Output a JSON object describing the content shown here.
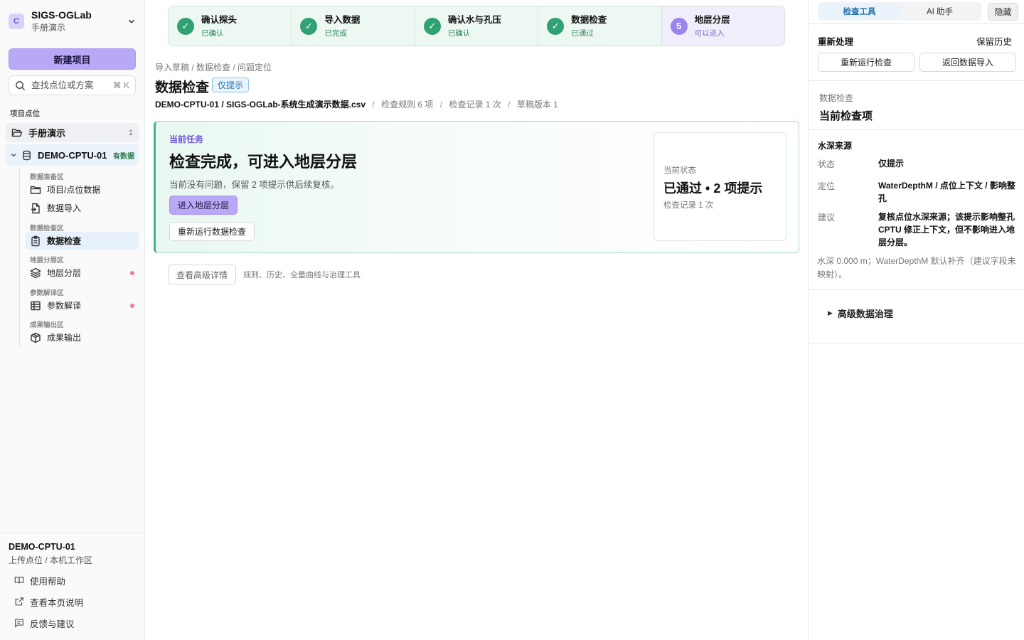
{
  "workspace": {
    "avatar": "C",
    "title": "SIGS-OGLab",
    "subtitle": "手册演示"
  },
  "sidebar": {
    "new_project": "新建项目",
    "search_placeholder": "查找点位或方案",
    "search_shortcut": "⌘ K",
    "section_label": "项目点位",
    "project": {
      "label": "手册演示",
      "count": "1"
    },
    "site": {
      "label": "DEMO-CPTU-01",
      "tag": "有数据"
    },
    "groups": [
      "数据准备区",
      "数据检查区",
      "地层分层区",
      "参数解译区",
      "成果输出区"
    ],
    "items": [
      {
        "label": "项目/点位数据"
      },
      {
        "label": "数据导入"
      },
      {
        "label": "数据检查"
      },
      {
        "label": "地层分层"
      },
      {
        "label": "参数解译"
      },
      {
        "label": "成果输出"
      }
    ],
    "footer": {
      "title": "DEMO-CPTU-01",
      "subtitle": "上传点位 / 本机工作区",
      "links": [
        "使用帮助",
        "查看本页说明",
        "反馈与建议"
      ]
    }
  },
  "steps": [
    {
      "title": "确认探头",
      "status": "已确认"
    },
    {
      "title": "导入数据",
      "status": "已完成"
    },
    {
      "title": "确认水与孔压",
      "status": "已确认"
    },
    {
      "title": "数据检查",
      "status": "已通过"
    },
    {
      "num": "5",
      "title": "地层分层",
      "status": "可以进入"
    }
  ],
  "main": {
    "breadcrumb": "导入草稿 / 数据检查 / 问题定位",
    "title": "数据检查",
    "badge": "仅提示",
    "meta": {
      "file": "DEMO-CPTU-01 / SIGS-OGLab-系统生成演示数据.csv",
      "rules": "检查规则 6 项",
      "records": "检查记录 1 次",
      "draft": "草稿版本 1",
      "sep": "/"
    },
    "task": {
      "label": "当前任务",
      "title": "检查完成，可进入地层分层",
      "desc": "当前没有问题，保留 2 项提示供后续复核。",
      "primary": "进入地层分层",
      "secondary": "重新运行数据检查",
      "status_label": "当前状态",
      "status_value": "已通过 • 2 项提示",
      "status_records": "检查记录 1 次"
    },
    "advanced": {
      "button": "查看高级详情",
      "note": "规则、历史、全量曲线与治理工具"
    }
  },
  "right": {
    "tabs": [
      "检查工具",
      "AI 助手"
    ],
    "hide": "隐藏",
    "reprocess": {
      "title": "重新处理",
      "keep": "保留历史",
      "rerun": "重新运行检查",
      "back": "返回数据导入"
    },
    "check": {
      "label": "数据检查",
      "title": "当前检查项"
    },
    "water": {
      "title": "水深来源",
      "status_k": "状态",
      "status_v": "仅提示",
      "loc_k": "定位",
      "loc_v": "WaterDepthM / 点位上下文 / 影响整孔",
      "advice_k": "建议",
      "advice_v": "复核点位水深来源；该提示影响整孔 CPTU 修正上下文，但不影响进入地层分层。",
      "note": "水深 0.000 m；WaterDepthM 默认补齐（建议字段未映射）。"
    },
    "governance": "高级数据治理"
  },
  "colors": {
    "accent": "#b9a8f5",
    "success": "#2fa173",
    "info": "#1f6fae",
    "warn_dot": "#ef7d93"
  }
}
